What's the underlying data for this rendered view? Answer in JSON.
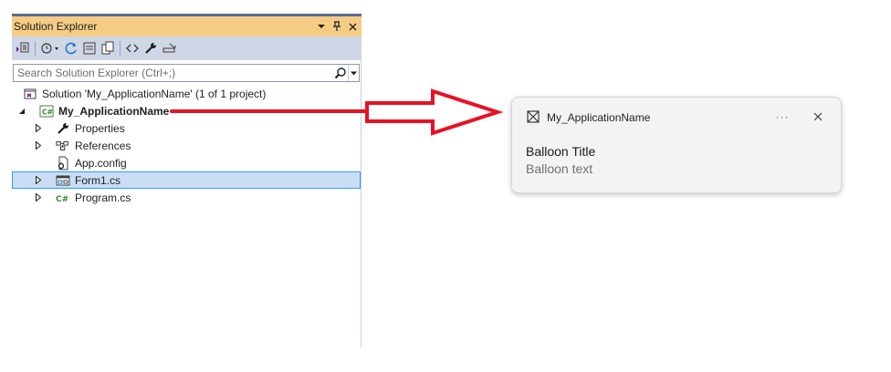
{
  "solution_explorer": {
    "title": "Solution Explorer",
    "title_buttons": [
      {
        "name": "window-position-dropdown",
        "glyph": "▾"
      },
      {
        "name": "auto-hide-pin",
        "glyph": "📌"
      },
      {
        "name": "close",
        "glyph": "✕"
      }
    ],
    "toolbar_tools": [
      "switch-views",
      "pending-changes-filter",
      "sync-with-active-document",
      "collapse-all",
      "show-all-files",
      "view-code",
      "properties",
      "preview-selected-items"
    ],
    "search_placeholder": "Search Solution Explorer (Ctrl+;)",
    "tree": [
      {
        "label": "Solution 'My_ApplicationName' (1 of 1 project)",
        "icon": "solution-icon",
        "expander": "none",
        "indent": 0,
        "bold": false,
        "selected": false
      },
      {
        "label": "My_ApplicationName",
        "icon": "csharp-project-icon",
        "expander": "expanded",
        "indent": 1,
        "bold": true,
        "selected": false
      },
      {
        "label": "Properties",
        "icon": "wrench-icon",
        "expander": "collapsed",
        "indent": 2,
        "bold": false,
        "selected": false
      },
      {
        "label": "References",
        "icon": "references-icon",
        "expander": "collapsed",
        "indent": 2,
        "bold": false,
        "selected": false
      },
      {
        "label": "App.config",
        "icon": "config-file-icon",
        "expander": "none",
        "indent": 2,
        "bold": false,
        "selected": false
      },
      {
        "label": "Form1.cs",
        "icon": "form-icon",
        "expander": "collapsed",
        "indent": 2,
        "bold": false,
        "selected": true
      },
      {
        "label": "Program.cs",
        "icon": "csharp-file-icon",
        "expander": "collapsed",
        "indent": 2,
        "bold": false,
        "selected": false
      }
    ]
  },
  "arrow": {
    "color": "#e81123"
  },
  "toast": {
    "app_name": "My_ApplicationName",
    "more_glyph": "···",
    "title": "Balloon Title",
    "text": "Balloon text"
  },
  "colors": {
    "title_bar": "#f5cc84",
    "toolbar": "#cfd6e5",
    "selection": "#c9def5",
    "selection_border": "#3399ff",
    "csharp_green": "#388a34"
  }
}
